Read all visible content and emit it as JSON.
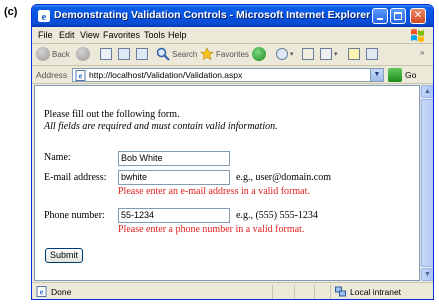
{
  "figure_label": "(c)",
  "window": {
    "title": "Demonstrating Validation Controls - Microsoft Internet Explorer"
  },
  "menu": [
    "File",
    "Edit",
    "View",
    "Favorites",
    "Tools",
    "Help"
  ],
  "toolbar": {
    "back_label": "Back",
    "search_label": "Search",
    "favorites_label": "Favorites"
  },
  "address": {
    "label": "Address",
    "url": "http://localhost/Validation/Validation.aspx",
    "go_label": "Go"
  },
  "form": {
    "intro": "Please fill out the following form.",
    "note": "All fields are required and must contain valid information.",
    "name_label": "Name:",
    "name_value": "Bob White",
    "email_label": "E-mail address:",
    "email_value": "bwhite",
    "email_hint": "e.g., user@domain.com",
    "email_error": "Please enter an e-mail address in a valid format.",
    "phone_label": "Phone number:",
    "phone_value": "55-1234",
    "phone_hint": "e.g., (555) 555-1234",
    "phone_error": "Please enter a phone number in a valid format.",
    "submit_label": "Submit"
  },
  "status": {
    "text": "Done",
    "zone": "Local intranet"
  },
  "colors": {
    "error": "#e02020",
    "titlebar": "#0753e0"
  }
}
